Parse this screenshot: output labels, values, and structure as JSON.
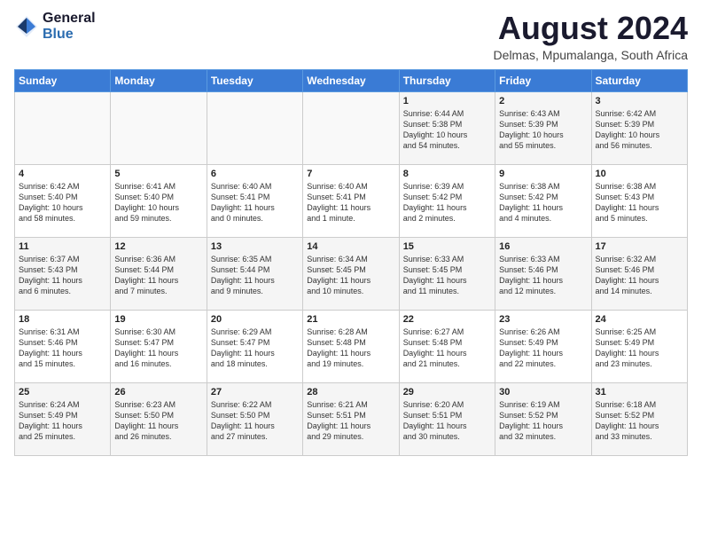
{
  "logo": {
    "general": "General",
    "blue": "Blue"
  },
  "header": {
    "month_year": "August 2024",
    "location": "Delmas, Mpumalanga, South Africa"
  },
  "days_of_week": [
    "Sunday",
    "Monday",
    "Tuesday",
    "Wednesday",
    "Thursday",
    "Friday",
    "Saturday"
  ],
  "weeks": [
    [
      {
        "day": "",
        "content": ""
      },
      {
        "day": "",
        "content": ""
      },
      {
        "day": "",
        "content": ""
      },
      {
        "day": "",
        "content": ""
      },
      {
        "day": "1",
        "content": "Sunrise: 6:44 AM\nSunset: 5:38 PM\nDaylight: 10 hours\nand 54 minutes."
      },
      {
        "day": "2",
        "content": "Sunrise: 6:43 AM\nSunset: 5:39 PM\nDaylight: 10 hours\nand 55 minutes."
      },
      {
        "day": "3",
        "content": "Sunrise: 6:42 AM\nSunset: 5:39 PM\nDaylight: 10 hours\nand 56 minutes."
      }
    ],
    [
      {
        "day": "4",
        "content": "Sunrise: 6:42 AM\nSunset: 5:40 PM\nDaylight: 10 hours\nand 58 minutes."
      },
      {
        "day": "5",
        "content": "Sunrise: 6:41 AM\nSunset: 5:40 PM\nDaylight: 10 hours\nand 59 minutes."
      },
      {
        "day": "6",
        "content": "Sunrise: 6:40 AM\nSunset: 5:41 PM\nDaylight: 11 hours\nand 0 minutes."
      },
      {
        "day": "7",
        "content": "Sunrise: 6:40 AM\nSunset: 5:41 PM\nDaylight: 11 hours\nand 1 minute."
      },
      {
        "day": "8",
        "content": "Sunrise: 6:39 AM\nSunset: 5:42 PM\nDaylight: 11 hours\nand 2 minutes."
      },
      {
        "day": "9",
        "content": "Sunrise: 6:38 AM\nSunset: 5:42 PM\nDaylight: 11 hours\nand 4 minutes."
      },
      {
        "day": "10",
        "content": "Sunrise: 6:38 AM\nSunset: 5:43 PM\nDaylight: 11 hours\nand 5 minutes."
      }
    ],
    [
      {
        "day": "11",
        "content": "Sunrise: 6:37 AM\nSunset: 5:43 PM\nDaylight: 11 hours\nand 6 minutes."
      },
      {
        "day": "12",
        "content": "Sunrise: 6:36 AM\nSunset: 5:44 PM\nDaylight: 11 hours\nand 7 minutes."
      },
      {
        "day": "13",
        "content": "Sunrise: 6:35 AM\nSunset: 5:44 PM\nDaylight: 11 hours\nand 9 minutes."
      },
      {
        "day": "14",
        "content": "Sunrise: 6:34 AM\nSunset: 5:45 PM\nDaylight: 11 hours\nand 10 minutes."
      },
      {
        "day": "15",
        "content": "Sunrise: 6:33 AM\nSunset: 5:45 PM\nDaylight: 11 hours\nand 11 minutes."
      },
      {
        "day": "16",
        "content": "Sunrise: 6:33 AM\nSunset: 5:46 PM\nDaylight: 11 hours\nand 12 minutes."
      },
      {
        "day": "17",
        "content": "Sunrise: 6:32 AM\nSunset: 5:46 PM\nDaylight: 11 hours\nand 14 minutes."
      }
    ],
    [
      {
        "day": "18",
        "content": "Sunrise: 6:31 AM\nSunset: 5:46 PM\nDaylight: 11 hours\nand 15 minutes."
      },
      {
        "day": "19",
        "content": "Sunrise: 6:30 AM\nSunset: 5:47 PM\nDaylight: 11 hours\nand 16 minutes."
      },
      {
        "day": "20",
        "content": "Sunrise: 6:29 AM\nSunset: 5:47 PM\nDaylight: 11 hours\nand 18 minutes."
      },
      {
        "day": "21",
        "content": "Sunrise: 6:28 AM\nSunset: 5:48 PM\nDaylight: 11 hours\nand 19 minutes."
      },
      {
        "day": "22",
        "content": "Sunrise: 6:27 AM\nSunset: 5:48 PM\nDaylight: 11 hours\nand 21 minutes."
      },
      {
        "day": "23",
        "content": "Sunrise: 6:26 AM\nSunset: 5:49 PM\nDaylight: 11 hours\nand 22 minutes."
      },
      {
        "day": "24",
        "content": "Sunrise: 6:25 AM\nSunset: 5:49 PM\nDaylight: 11 hours\nand 23 minutes."
      }
    ],
    [
      {
        "day": "25",
        "content": "Sunrise: 6:24 AM\nSunset: 5:49 PM\nDaylight: 11 hours\nand 25 minutes."
      },
      {
        "day": "26",
        "content": "Sunrise: 6:23 AM\nSunset: 5:50 PM\nDaylight: 11 hours\nand 26 minutes."
      },
      {
        "day": "27",
        "content": "Sunrise: 6:22 AM\nSunset: 5:50 PM\nDaylight: 11 hours\nand 27 minutes."
      },
      {
        "day": "28",
        "content": "Sunrise: 6:21 AM\nSunset: 5:51 PM\nDaylight: 11 hours\nand 29 minutes."
      },
      {
        "day": "29",
        "content": "Sunrise: 6:20 AM\nSunset: 5:51 PM\nDaylight: 11 hours\nand 30 minutes."
      },
      {
        "day": "30",
        "content": "Sunrise: 6:19 AM\nSunset: 5:52 PM\nDaylight: 11 hours\nand 32 minutes."
      },
      {
        "day": "31",
        "content": "Sunrise: 6:18 AM\nSunset: 5:52 PM\nDaylight: 11 hours\nand 33 minutes."
      }
    ]
  ]
}
